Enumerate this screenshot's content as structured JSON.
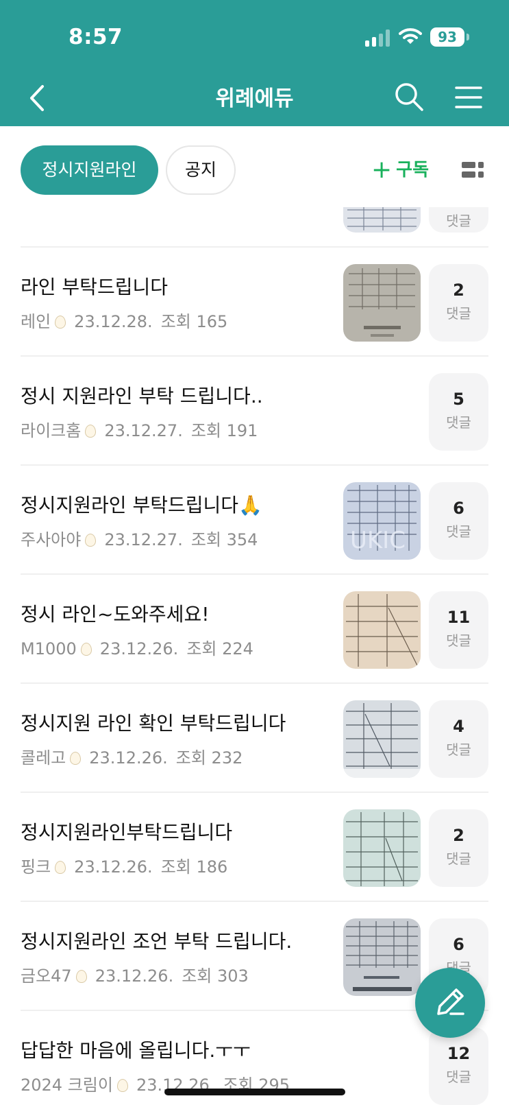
{
  "status_bar": {
    "time": "8:57",
    "battery": "93"
  },
  "header": {
    "title": "위례에듀"
  },
  "tabs": [
    {
      "label": "정시지원라인",
      "active": true
    },
    {
      "label": "공지",
      "active": false
    }
  ],
  "actions": {
    "subscribe_label": "구독",
    "subscribe_icon": "plus-icon",
    "view_icon": "grid-view-icon"
  },
  "partial_row": {
    "comment_label": "댓글"
  },
  "posts": [
    {
      "title": "라인 부탁드립니다",
      "author": "레인",
      "date": "23.12.28.",
      "views_label": "조회 165",
      "comments": "2",
      "comment_label": "댓글",
      "has_thumb": true
    },
    {
      "title": "정시 지원라인 부탁 드립니다..",
      "author": "라이크홈",
      "date": "23.12.27.",
      "views_label": "조회 191",
      "comments": "5",
      "comment_label": "댓글",
      "has_thumb": false
    },
    {
      "title": "정시지원라인 부탁드립니다🙏",
      "author": "주사아야",
      "date": "23.12.27.",
      "views_label": "조회 354",
      "comments": "6",
      "comment_label": "댓글",
      "has_thumb": true
    },
    {
      "title": "정시 라인~도와주세요!",
      "author": "M1000",
      "date": "23.12.26.",
      "views_label": "조회 224",
      "comments": "11",
      "comment_label": "댓글",
      "has_thumb": true
    },
    {
      "title": "정시지원 라인 확인 부탁드립니다",
      "author": "콜레고",
      "date": "23.12.26.",
      "views_label": "조회 232",
      "comments": "4",
      "comment_label": "댓글",
      "has_thumb": true
    },
    {
      "title": "정시지원라인부탁드립니다",
      "author": "핑크",
      "date": "23.12.26.",
      "views_label": "조회 186",
      "comments": "2",
      "comment_label": "댓글",
      "has_thumb": true
    },
    {
      "title": "정시지원라인 조언 부탁 드립니다.",
      "author": "금오47",
      "date": "23.12.26.",
      "views_label": "조회 303",
      "comments": "6",
      "comment_label": "댓글",
      "has_thumb": true
    },
    {
      "title": "답답한 마음에 올립니다.ㅜㅜ",
      "author": "2024 크림이",
      "date": "23.12.26.",
      "views_label": "조회 295",
      "comments": "12",
      "comment_label": "댓글",
      "has_thumb": false
    }
  ],
  "fab": {
    "icon": "pencil-icon"
  },
  "colors": {
    "brand": "#2a9d97",
    "subscribe": "#19b15c",
    "meta": "#8d8d8d"
  }
}
